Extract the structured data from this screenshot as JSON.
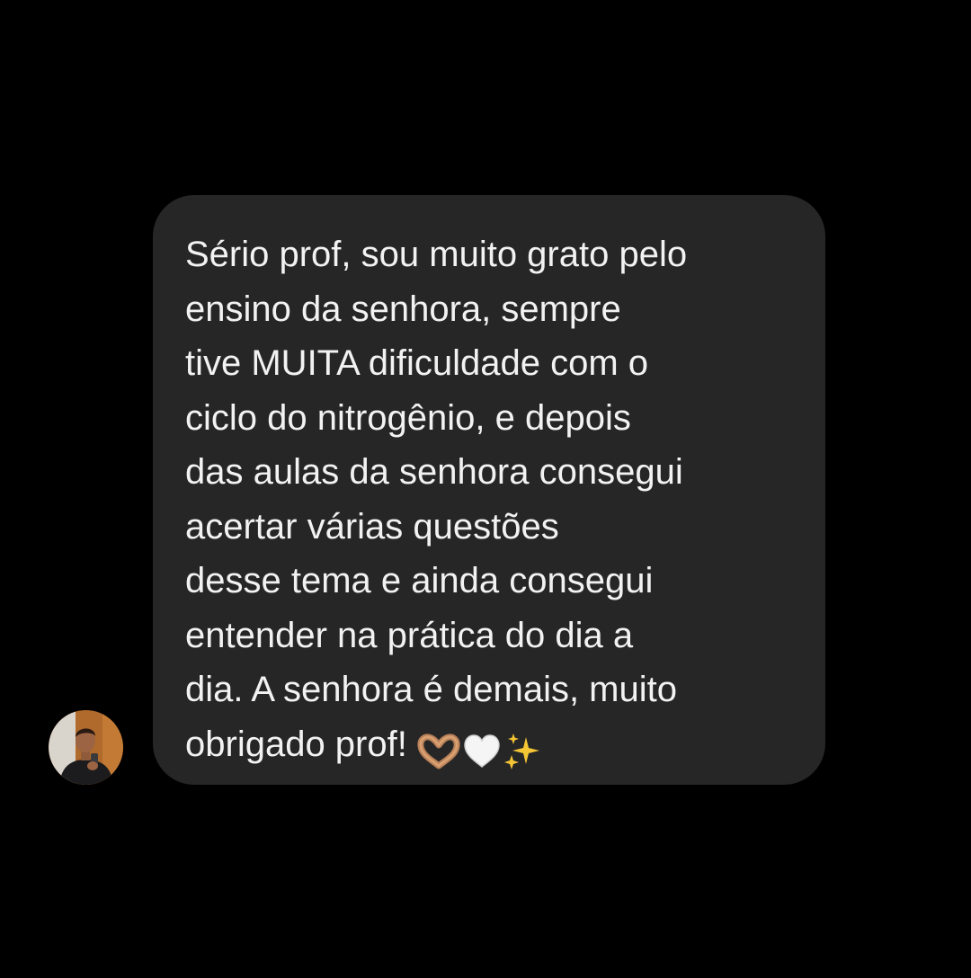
{
  "conversation": {
    "message": {
      "lines": [
        "Sério prof, sou muito grato pelo",
        "ensino da senhora, sempre",
        "tive MUITA dificuldade com o",
        "ciclo do nitrogênio, e depois",
        "das aulas da senhora consegui",
        "acertar várias questões",
        "desse tema e ainda consegui",
        "entender na prática do dia a",
        "dia. A senhora é demais, muito",
        "obrigado prof!"
      ],
      "emojis": [
        "heart-hands-emoji",
        "white-heart-emoji",
        "sparkles-emoji"
      ]
    },
    "sender": {
      "avatar_icon": "user-avatar"
    }
  },
  "colors": {
    "background": "#000000",
    "bubble": "#262626",
    "text": "#f2f2f2"
  }
}
